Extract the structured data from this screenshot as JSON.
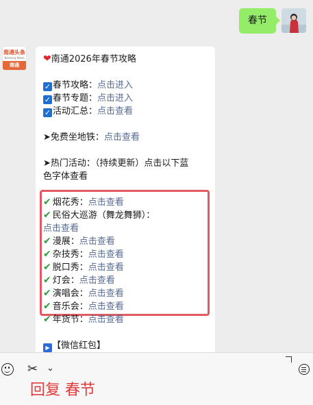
{
  "user_message": {
    "text": "春节"
  },
  "bot": {
    "avatar_logo_top": "南通头条",
    "avatar_logo_sub": "Nantong News",
    "avatar_logo_band": "南通",
    "title": "南通2026年春节攻略",
    "guide_items": [
      {
        "label": "春节攻略：",
        "link": "点击进入"
      },
      {
        "label": "春节专题：",
        "link": "点击进入"
      },
      {
        "label": "活动汇总：",
        "link": "点击查看"
      }
    ],
    "metro_label": "➤免费坐地铁：",
    "metro_link": "点击查看",
    "hot_line1": "➤热门活动：（持续更新）点击以下蓝",
    "hot_line2": "色字体查看",
    "activities": [
      {
        "label": "烟花秀：",
        "link": "点击查看"
      },
      {
        "label": "民俗大巡游（舞龙舞狮）：",
        "link": "点击查看"
      },
      {
        "label": "漫展：",
        "link": "点击查看"
      },
      {
        "label": "杂技秀：",
        "link": "点击查看"
      },
      {
        "label": "脱口秀：",
        "link": "点击查看"
      },
      {
        "label": "灯会：",
        "link": "点击查看"
      },
      {
        "label": "演唱会：",
        "link": "点击查看"
      },
      {
        "label": "音乐会：",
        "link": "点击查看"
      },
      {
        "label": "年货节：",
        "link": "点击查看"
      }
    ],
    "wechat_red_packet": "【微信红包】"
  },
  "bottom_bar": {
    "reply_hint": "回复 春节"
  },
  "colors": {
    "link": "#576b95",
    "user_bubble": "#95ec69",
    "highlight_border": "#e25a5f",
    "reply_hint": "#e23b3b"
  }
}
